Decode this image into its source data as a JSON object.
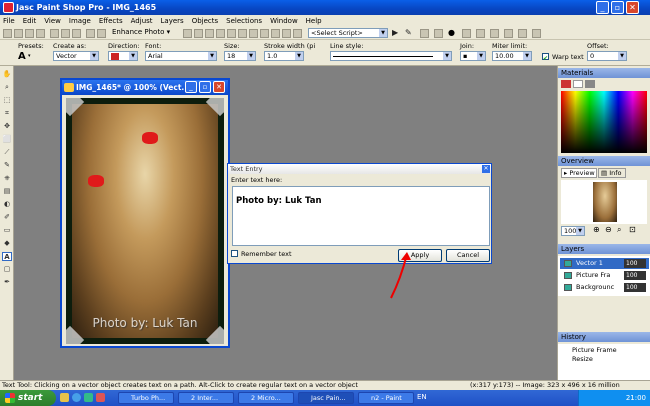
{
  "app": {
    "title": "Jasc Paint Shop Pro - IMG_1465"
  },
  "menu": [
    "File",
    "Edit",
    "View",
    "Image",
    "Effects",
    "Adjust",
    "Layers",
    "Objects",
    "Selections",
    "Window",
    "Help"
  ],
  "toolbar": {
    "enhance_label": "Enhance Photo",
    "script_select": "<Select Script>"
  },
  "options": {
    "presets_label": "Presets:",
    "create_as_label": "Create as:",
    "create_as_value": "Vector",
    "direction_label": "Direction:",
    "font_label": "Font:",
    "font_value": "Arial",
    "size_label": "Size:",
    "size_value": "18",
    "stroke_label": "Stroke width (pi",
    "stroke_value": "1.0",
    "linestyle_label": "Line style:",
    "join_label": "Join:",
    "miter_label": "Miter limit:",
    "miter_value": "10.00",
    "warp_label": "Warp text",
    "offset_label": "Offset:",
    "offset_value": "0"
  },
  "image_window": {
    "title": "IMG_1465* @ 100% (Vect...",
    "watermark": "Photo by: Luk Tan"
  },
  "dialog": {
    "title": "Text Entry",
    "prompt": "Enter text here:",
    "text": "Photo by: Luk Tan",
    "remember_label": "Remember text",
    "apply_label": "Apply",
    "cancel_label": "Cancel"
  },
  "panels": {
    "materials": "Materials",
    "overview": "Overview",
    "preview_tab": "Preview",
    "info_tab": "Info",
    "zoom_value": "100",
    "layers": "Layers",
    "layer_items": [
      {
        "name": "Vector 1",
        "opacity": "100"
      },
      {
        "name": "Picture Fra",
        "opacity": "100"
      },
      {
        "name": "Backgrounc",
        "opacity": "100"
      }
    ],
    "history": "History",
    "history_items": [
      "Picture Frame",
      "Resize"
    ]
  },
  "status": {
    "hint": "Text Tool: Clicking on a vector object creates text on a path. Alt-Click to create regular text on a vector object",
    "coords": "(x:317 y:173) -- Image: 323 x 496 x 16 million"
  },
  "taskbar": {
    "start": "start",
    "items": [
      "Turbo Ph...",
      "2 Inter...",
      "2 Micro...",
      "Jasc Pain...",
      "n2 - Paint"
    ],
    "lang": "EN",
    "time": "21:00"
  }
}
